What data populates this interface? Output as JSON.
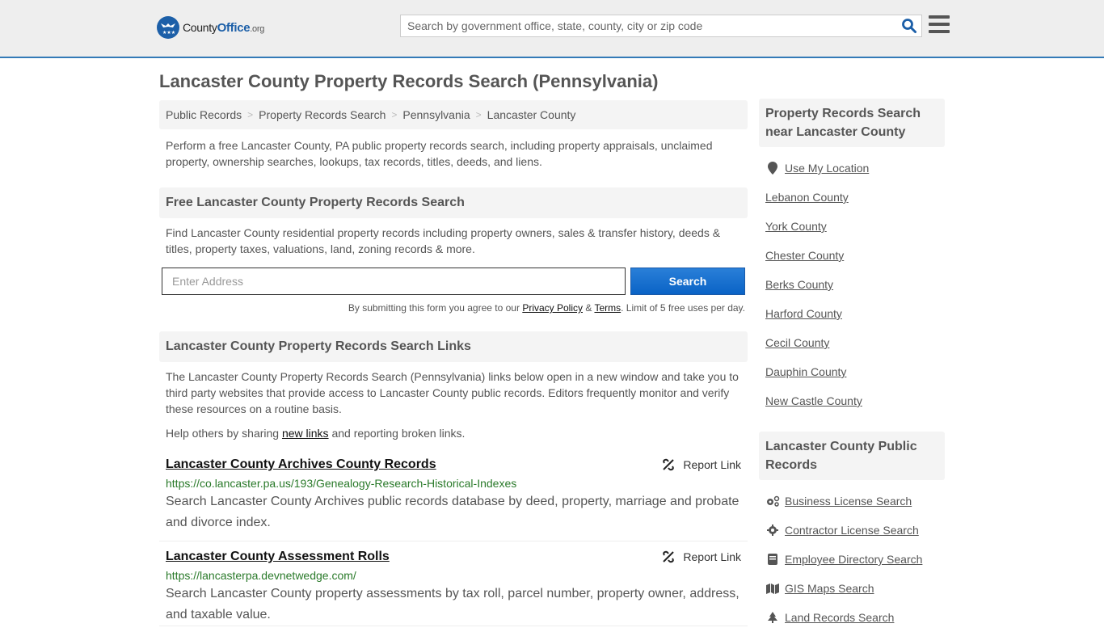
{
  "header": {
    "logo_county": "County",
    "logo_office": "Office",
    "logo_org": ".org",
    "search_placeholder": "Search by government office, state, county, city or zip code",
    "search_icon": "search-icon",
    "menu_icon": "hamburger-menu-icon"
  },
  "page": {
    "title": "Lancaster County Property Records Search (Pennsylvania)"
  },
  "breadcrumb": [
    {
      "label": "Public Records"
    },
    {
      "label": "Property Records Search"
    },
    {
      "label": "Pennsylvania"
    },
    {
      "label": "Lancaster County"
    }
  ],
  "breadcrumb_separator": ">",
  "intro": "Perform a free Lancaster County, PA public property records search, including property appraisals, unclaimed property, ownership searches, lookups, tax records, titles, deeds, and liens.",
  "free_search": {
    "heading": "Free Lancaster County Property Records Search",
    "description": "Find Lancaster County residential property records including property owners, sales & transfer history, deeds & titles, property taxes, valuations, land, zoning records & more.",
    "input_placeholder": "Enter Address",
    "input_value": "",
    "button_label": "Search",
    "disclaimer_prefix": "By submitting this form you agree to our ",
    "privacy_label": "Privacy Policy",
    "amp": " & ",
    "terms_label": "Terms",
    "disclaimer_suffix": ". Limit of 5 free uses per day."
  },
  "links_section": {
    "heading": "Lancaster County Property Records Search Links",
    "description": "The Lancaster County Property Records Search (Pennsylvania) links below open in a new window and take you to third party websites that provide access to Lancaster County public records. Editors frequently monitor and verify these resources on a routine basis.",
    "help_prefix": "Help others by sharing ",
    "help_link": "new links",
    "help_suffix": " and reporting broken links.",
    "report_label": "Report Link",
    "records": [
      {
        "title": "Lancaster County Archives County Records",
        "url": "https://co.lancaster.pa.us/193/Genealogy-Research-Historical-Indexes",
        "description": "Search Lancaster County Archives public records database by deed, property, marriage and probate and divorce index."
      },
      {
        "title": "Lancaster County Assessment Rolls",
        "url": "https://lancasterpa.devnetwedge.com/",
        "description": "Search Lancaster County property assessments by tax roll, parcel number, property owner, address, and taxable value."
      }
    ]
  },
  "sidebar": {
    "nearby_heading": "Property Records Search near Lancaster County",
    "use_location": "Use My Location",
    "nearby": [
      "Lebanon County",
      "York County",
      "Chester County",
      "Berks County",
      "Harford County",
      "Cecil County",
      "Dauphin County",
      "New Castle County"
    ],
    "public_records_heading": "Lancaster County Public Records",
    "public_records": [
      {
        "label": "Business License Search",
        "icon": "cogs-icon"
      },
      {
        "label": "Contractor License Search",
        "icon": "cog-icon"
      },
      {
        "label": "Employee Directory Search",
        "icon": "book-icon"
      },
      {
        "label": "GIS Maps Search",
        "icon": "map-icon"
      },
      {
        "label": "Land Records Search",
        "icon": "tree-icon"
      }
    ]
  },
  "colors": {
    "accent": "#337ab7",
    "button": "#0a63c6",
    "url_green": "#2a7a2a",
    "text": "#555555",
    "panel": "#f4f4f4"
  }
}
